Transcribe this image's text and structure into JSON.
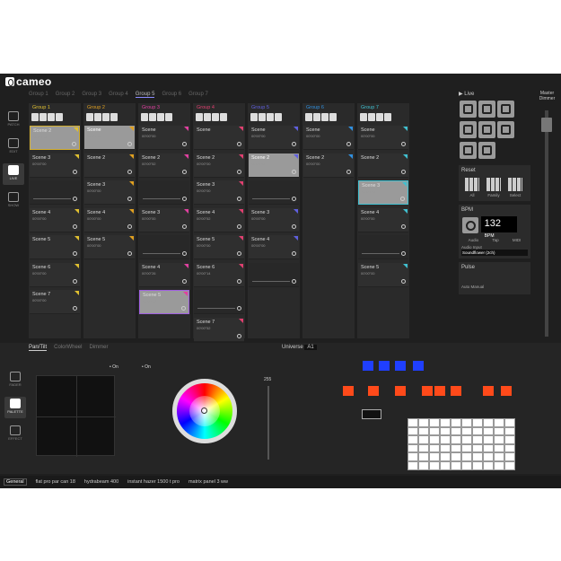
{
  "app": {
    "logo": "cameo"
  },
  "groups": {
    "tabs": [
      "Group 1",
      "Group 2",
      "Group 3",
      "Group 4",
      "Group 5",
      "Group 6",
      "Group 7"
    ],
    "active": 4
  },
  "nav": {
    "items": [
      "PATCH",
      "EDIT",
      "LIVE",
      "SHOW"
    ],
    "active": "LIVE"
  },
  "columns": [
    {
      "name": "Group 1",
      "color": "#e0c030",
      "scenes": [
        {
          "label": "Scene 2",
          "time": "00'00\"42",
          "state": "yellow"
        },
        {
          "label": "Scene 3",
          "time": "00'00\"00"
        },
        {
          "label": "",
          "time": "",
          "state": "slider"
        },
        {
          "label": "Scene 4",
          "time": "00'00\"00"
        },
        {
          "label": "Scene 5",
          "time": ""
        },
        {
          "label": "Scene 6",
          "time": "00'00\"00"
        },
        {
          "label": "Scene 7",
          "time": "00'00\"00"
        }
      ]
    },
    {
      "name": "Group 2",
      "color": "#e0a020",
      "scenes": [
        {
          "label": "Scene",
          "time": "00'00\"12",
          "state": "active"
        },
        {
          "label": "Scene 2",
          "time": ""
        },
        {
          "label": "Scene 3",
          "time": "00'00\"00"
        },
        {
          "label": "Scene 4",
          "time": "00'00\"00"
        },
        {
          "label": "Scene 5",
          "time": "00'00\"00"
        }
      ]
    },
    {
      "name": "Group 3",
      "color": "#e040a0",
      "scenes": [
        {
          "label": "Scene",
          "time": "00'00\"00"
        },
        {
          "label": "Scene 2",
          "time": "00'00\"52"
        },
        {
          "label": "",
          "time": "",
          "state": "slider"
        },
        {
          "label": "Scene 3",
          "time": "00'00\"00"
        },
        {
          "label": "",
          "time": "",
          "state": "slider"
        },
        {
          "label": "Scene 4",
          "time": "00'00\"26"
        },
        {
          "label": "Scene 5",
          "time": "00'00\"48",
          "state": "purple"
        }
      ]
    },
    {
      "name": "Group 4",
      "color": "#e04070",
      "scenes": [
        {
          "label": "Scene",
          "time": ""
        },
        {
          "label": "Scene 2",
          "time": "00'00\"00"
        },
        {
          "label": "Scene 3",
          "time": "00'00\"00"
        },
        {
          "label": "Scene 4",
          "time": "00'00\"52"
        },
        {
          "label": "Scene 5",
          "time": "00'00\"00"
        },
        {
          "label": "Scene 6",
          "time": "00'00\"14"
        },
        {
          "label": "",
          "time": "",
          "state": "slider"
        },
        {
          "label": "Scene 7",
          "time": "00'00\"52"
        }
      ]
    },
    {
      "name": "Group 5",
      "color": "#6060e0",
      "scenes": [
        {
          "label": "Scene",
          "time": "00'00\"00"
        },
        {
          "label": "Scene 2",
          "time": "00'00\"52",
          "state": "active"
        },
        {
          "label": "",
          "time": "",
          "state": "slider"
        },
        {
          "label": "Scene 3",
          "time": "00'00\"00"
        },
        {
          "label": "Scene 4",
          "time": "00'00\"00"
        },
        {
          "label": "",
          "time": "",
          "state": "slider"
        }
      ]
    },
    {
      "name": "Group 6",
      "color": "#3090e0",
      "scenes": [
        {
          "label": "Scene",
          "time": "00'00\"00"
        },
        {
          "label": "Scene 2",
          "time": "00'00\"00"
        }
      ]
    },
    {
      "name": "Group 7",
      "color": "#40c0d0",
      "scenes": [
        {
          "label": "Scene",
          "time": "00'00\"00"
        },
        {
          "label": "Scene 2",
          "time": ""
        },
        {
          "label": "Scene 3",
          "time": "00'00\"52",
          "state": "cyan"
        },
        {
          "label": "Scene 4",
          "time": "00'00\"00"
        },
        {
          "label": "",
          "time": "",
          "state": "slider"
        },
        {
          "label": "Scene 5",
          "time": "00'00\"00"
        }
      ]
    }
  ],
  "live": {
    "title": "Live",
    "reset": "Reset",
    "reset_items": [
      "All",
      "Family",
      "Select"
    ],
    "bpm_title": "BPM",
    "bpm_value": "132",
    "bpm_unit": "BPM",
    "bpm_modes": [
      "Audio",
      "Tap",
      "MIDI"
    ],
    "audio_input_label": "Audio Input",
    "audio_input_value": "Soundflower (2ch)",
    "pulse_title": "Pulse",
    "pulse_modes": [
      "Auto",
      "Manual"
    ]
  },
  "master": {
    "label": "Master Dimmer"
  },
  "bottom_nav": [
    "FADER",
    "PALETTE",
    "EFFECT"
  ],
  "fx": {
    "tabs": [
      "Pan/Tilt",
      "ColorWheel",
      "Dimmer"
    ],
    "on1": "On",
    "on2": "On",
    "value": "255"
  },
  "universe": {
    "label": "Universe",
    "value": "A1"
  },
  "status": {
    "fixtures": [
      "General",
      "flat pro par can 18",
      "hydrabeam 400",
      "instant hazer 1500 t pro",
      "matrix panel 3 ww"
    ]
  }
}
